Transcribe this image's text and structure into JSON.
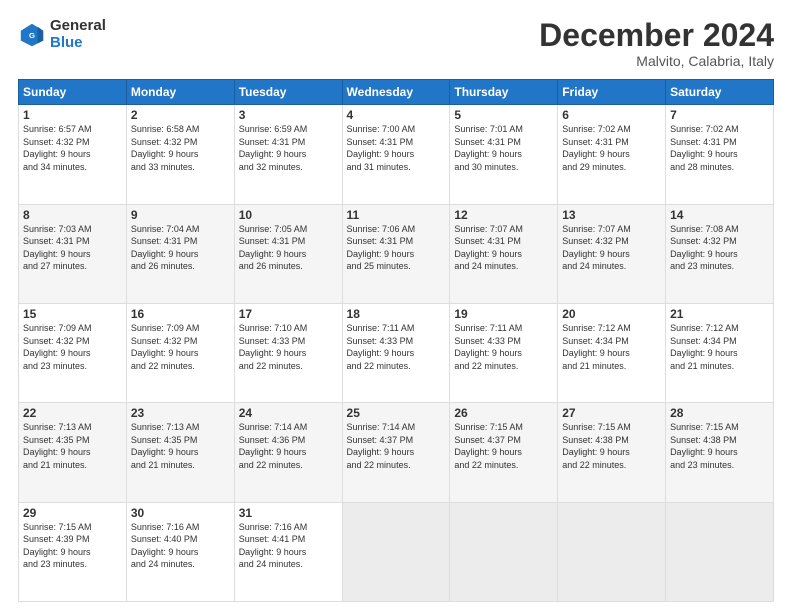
{
  "header": {
    "logo_general": "General",
    "logo_blue": "Blue",
    "month_title": "December 2024",
    "location": "Malvito, Calabria, Italy"
  },
  "days_of_week": [
    "Sunday",
    "Monday",
    "Tuesday",
    "Wednesday",
    "Thursday",
    "Friday",
    "Saturday"
  ],
  "weeks": [
    [
      {
        "day": "1",
        "info": "Sunrise: 6:57 AM\nSunset: 4:32 PM\nDaylight: 9 hours\nand 34 minutes."
      },
      {
        "day": "2",
        "info": "Sunrise: 6:58 AM\nSunset: 4:32 PM\nDaylight: 9 hours\nand 33 minutes."
      },
      {
        "day": "3",
        "info": "Sunrise: 6:59 AM\nSunset: 4:31 PM\nDaylight: 9 hours\nand 32 minutes."
      },
      {
        "day": "4",
        "info": "Sunrise: 7:00 AM\nSunset: 4:31 PM\nDaylight: 9 hours\nand 31 minutes."
      },
      {
        "day": "5",
        "info": "Sunrise: 7:01 AM\nSunset: 4:31 PM\nDaylight: 9 hours\nand 30 minutes."
      },
      {
        "day": "6",
        "info": "Sunrise: 7:02 AM\nSunset: 4:31 PM\nDaylight: 9 hours\nand 29 minutes."
      },
      {
        "day": "7",
        "info": "Sunrise: 7:02 AM\nSunset: 4:31 PM\nDaylight: 9 hours\nand 28 minutes."
      }
    ],
    [
      {
        "day": "8",
        "info": "Sunrise: 7:03 AM\nSunset: 4:31 PM\nDaylight: 9 hours\nand 27 minutes."
      },
      {
        "day": "9",
        "info": "Sunrise: 7:04 AM\nSunset: 4:31 PM\nDaylight: 9 hours\nand 26 minutes."
      },
      {
        "day": "10",
        "info": "Sunrise: 7:05 AM\nSunset: 4:31 PM\nDaylight: 9 hours\nand 26 minutes."
      },
      {
        "day": "11",
        "info": "Sunrise: 7:06 AM\nSunset: 4:31 PM\nDaylight: 9 hours\nand 25 minutes."
      },
      {
        "day": "12",
        "info": "Sunrise: 7:07 AM\nSunset: 4:31 PM\nDaylight: 9 hours\nand 24 minutes."
      },
      {
        "day": "13",
        "info": "Sunrise: 7:07 AM\nSunset: 4:32 PM\nDaylight: 9 hours\nand 24 minutes."
      },
      {
        "day": "14",
        "info": "Sunrise: 7:08 AM\nSunset: 4:32 PM\nDaylight: 9 hours\nand 23 minutes."
      }
    ],
    [
      {
        "day": "15",
        "info": "Sunrise: 7:09 AM\nSunset: 4:32 PM\nDaylight: 9 hours\nand 23 minutes."
      },
      {
        "day": "16",
        "info": "Sunrise: 7:09 AM\nSunset: 4:32 PM\nDaylight: 9 hours\nand 22 minutes."
      },
      {
        "day": "17",
        "info": "Sunrise: 7:10 AM\nSunset: 4:33 PM\nDaylight: 9 hours\nand 22 minutes."
      },
      {
        "day": "18",
        "info": "Sunrise: 7:11 AM\nSunset: 4:33 PM\nDaylight: 9 hours\nand 22 minutes."
      },
      {
        "day": "19",
        "info": "Sunrise: 7:11 AM\nSunset: 4:33 PM\nDaylight: 9 hours\nand 22 minutes."
      },
      {
        "day": "20",
        "info": "Sunrise: 7:12 AM\nSunset: 4:34 PM\nDaylight: 9 hours\nand 21 minutes."
      },
      {
        "day": "21",
        "info": "Sunrise: 7:12 AM\nSunset: 4:34 PM\nDaylight: 9 hours\nand 21 minutes."
      }
    ],
    [
      {
        "day": "22",
        "info": "Sunrise: 7:13 AM\nSunset: 4:35 PM\nDaylight: 9 hours\nand 21 minutes."
      },
      {
        "day": "23",
        "info": "Sunrise: 7:13 AM\nSunset: 4:35 PM\nDaylight: 9 hours\nand 21 minutes."
      },
      {
        "day": "24",
        "info": "Sunrise: 7:14 AM\nSunset: 4:36 PM\nDaylight: 9 hours\nand 22 minutes."
      },
      {
        "day": "25",
        "info": "Sunrise: 7:14 AM\nSunset: 4:37 PM\nDaylight: 9 hours\nand 22 minutes."
      },
      {
        "day": "26",
        "info": "Sunrise: 7:15 AM\nSunset: 4:37 PM\nDaylight: 9 hours\nand 22 minutes."
      },
      {
        "day": "27",
        "info": "Sunrise: 7:15 AM\nSunset: 4:38 PM\nDaylight: 9 hours\nand 22 minutes."
      },
      {
        "day": "28",
        "info": "Sunrise: 7:15 AM\nSunset: 4:38 PM\nDaylight: 9 hours\nand 23 minutes."
      }
    ],
    [
      {
        "day": "29",
        "info": "Sunrise: 7:15 AM\nSunset: 4:39 PM\nDaylight: 9 hours\nand 23 minutes."
      },
      {
        "day": "30",
        "info": "Sunrise: 7:16 AM\nSunset: 4:40 PM\nDaylight: 9 hours\nand 24 minutes."
      },
      {
        "day": "31",
        "info": "Sunrise: 7:16 AM\nSunset: 4:41 PM\nDaylight: 9 hours\nand 24 minutes."
      },
      {
        "day": "",
        "info": ""
      },
      {
        "day": "",
        "info": ""
      },
      {
        "day": "",
        "info": ""
      },
      {
        "day": "",
        "info": ""
      }
    ]
  ]
}
